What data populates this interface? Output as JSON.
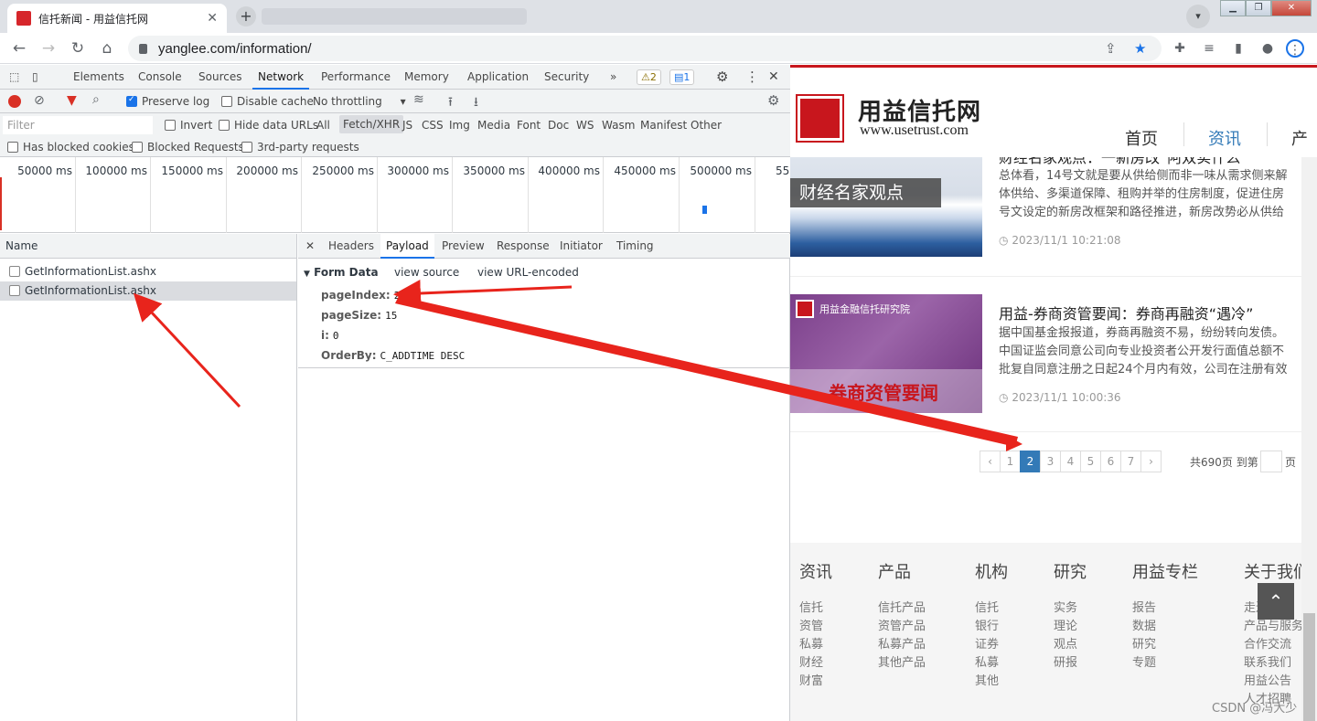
{
  "browser": {
    "tab_title": "信托新闻 - 用益信托网",
    "tab_close": "✕",
    "new_tab": "+",
    "url": "yanglee.com/information/"
  },
  "devtools": {
    "tabs": [
      "Elements",
      "Console",
      "Sources",
      "Network",
      "Performance",
      "Memory",
      "Application",
      "Security"
    ],
    "more": "»",
    "warnings": "⚠2",
    "messages": "1",
    "toolbar": {
      "preserve_log": "Preserve log",
      "disable_cache": "Disable cache",
      "throttling": "No throttling"
    },
    "filter": {
      "placeholder": "Filter",
      "invert": "Invert",
      "hide_data_urls": "Hide data URLs",
      "types": [
        "All",
        "Fetch/XHR",
        "JS",
        "CSS",
        "Img",
        "Media",
        "Font",
        "Doc",
        "WS",
        "Wasm",
        "Manifest",
        "Other"
      ],
      "has_blocked_cookies": "Has blocked cookies",
      "blocked_requests": "Blocked Requests",
      "third_party": "3rd-party requests"
    },
    "timeline_ticks": [
      "50000 ms",
      "100000 ms",
      "150000 ms",
      "200000 ms",
      "250000 ms",
      "300000 ms",
      "350000 ms",
      "400000 ms",
      "450000 ms",
      "500000 ms",
      "55"
    ],
    "requests": {
      "header": "Name",
      "rows": [
        "GetInformationList.ashx",
        "GetInformationList.ashx"
      ]
    },
    "detail": {
      "close": "✕",
      "tabs": [
        "Headers",
        "Payload",
        "Preview",
        "Response",
        "Initiator",
        "Timing"
      ],
      "section": "Form Data",
      "view_source": "view source",
      "view_url": "view URL-encoded",
      "params": [
        {
          "k": "pageIndex:",
          "v": "2"
        },
        {
          "k": "pageSize:",
          "v": "15"
        },
        {
          "k": "i:",
          "v": "0"
        },
        {
          "k": "OrderBy:",
          "v": "C_ADDTIME DESC"
        }
      ]
    }
  },
  "site": {
    "logo_text": "用益信托网",
    "logo_url": "www.usetrust.com",
    "nav": [
      "首页",
      "资讯",
      "产"
    ],
    "items": [
      {
        "thumb_label": "财经名家观点",
        "title": "财经名家观点：一新房改“阿双实什么”",
        "summary": [
          "总体看，14号文就是要从供给侧而非一味从需求侧来解",
          "体供给、多渠道保障、租购并举的住房制度，促进住房",
          "号文设定的新房改框架和路径推进，新房改势必从供给"
        ],
        "date": "2023/11/1 10:21:08"
      },
      {
        "thumb_brand": "用益金融信托研究院",
        "thumb_label": "券商资管要闻",
        "title": "用益-券商资管要闻：券商再融资“遇冷”",
        "summary": [
          "据中国基金报报道，券商再融资不易，纷纷转向发债。",
          "中国证监会同意公司向专业投资者公开发行面值总额不",
          "批复自同意注册之日起24个月内有效，公司在注册有效"
        ],
        "date": "2023/11/1 10:00:36"
      }
    ],
    "pager": {
      "prev": "‹",
      "pages": [
        "1",
        "2",
        "3",
        "4",
        "5",
        "6",
        "7"
      ],
      "current": "2",
      "next": "›",
      "total": "共690页 到第",
      "page_suffix": "页"
    },
    "footer": [
      {
        "head": "资讯",
        "links": [
          "信托",
          "资管",
          "私募",
          "财经",
          "财富"
        ]
      },
      {
        "head": "产品",
        "links": [
          "信托产品",
          "资管产品",
          "私募产品",
          "其他产品"
        ]
      },
      {
        "head": "机构",
        "links": [
          "信托",
          "银行",
          "证券",
          "私募",
          "其他"
        ]
      },
      {
        "head": "研究",
        "links": [
          "实务",
          "理论",
          "观点",
          "研报"
        ]
      },
      {
        "head": "用益专栏",
        "links": [
          "报告",
          "数据",
          "研究",
          "专题"
        ]
      },
      {
        "head": "关于我们",
        "links": [
          "走进",
          "产品与服务",
          "合作交流",
          "联系我们",
          "用益公告",
          "人才招聘"
        ]
      }
    ],
    "back_top": "⌃",
    "watermark": "CSDN @冯大少"
  }
}
